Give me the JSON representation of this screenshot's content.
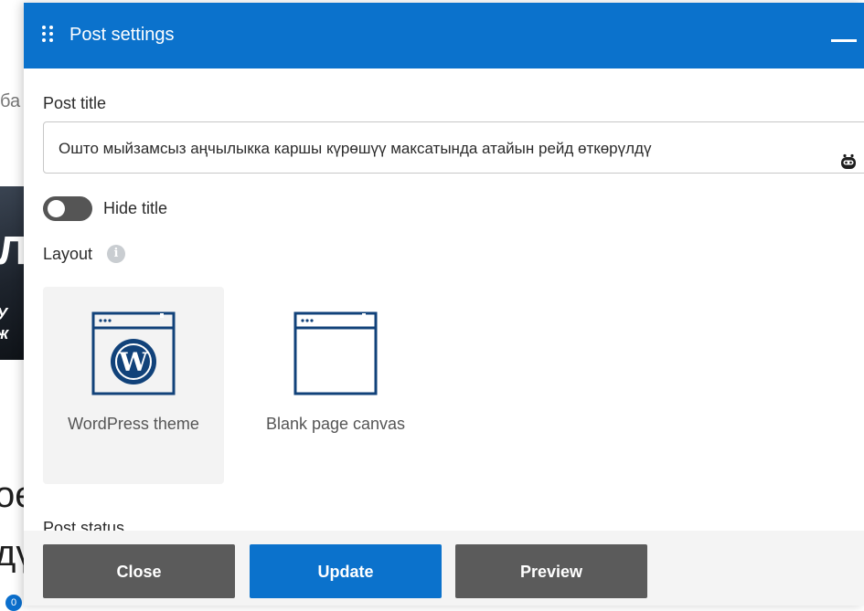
{
  "background": {
    "text_fragment": "ба",
    "image_big_text": "Л",
    "image_small_text": "У ж",
    "heading_fragment_1": "ое",
    "heading_fragment_2": "дү",
    "comment_count": "0"
  },
  "panel": {
    "title": "Post settings",
    "post_title_label": "Post title",
    "post_title_value": "Ошто мыйзамсыз аңчылыкка каршы күрөшүү максатында атайын рейд өткөрүлдү",
    "hide_title_label": "Hide title",
    "hide_title_on": false,
    "layout_label": "Layout",
    "layout_options": [
      {
        "label": "WordPress theme",
        "selected": true
      },
      {
        "label": "Blank page canvas",
        "selected": false
      }
    ],
    "post_status_label": "Post status"
  },
  "footer": {
    "close_label": "Close",
    "update_label": "Update",
    "preview_label": "Preview"
  },
  "colors": {
    "accent": "#0b72cc",
    "secondary_button": "#5b5b5b",
    "icon_stroke": "#11427a"
  },
  "icons": [
    "drag-handle-icon",
    "minimize-icon",
    "robot-icon",
    "info-icon",
    "wordpress-theme-icon",
    "blank-canvas-icon"
  ]
}
